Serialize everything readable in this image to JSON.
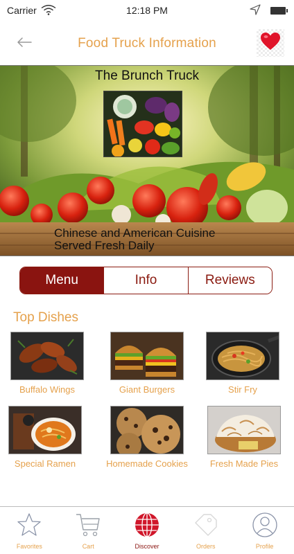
{
  "status_bar": {
    "carrier": "Carrier",
    "time": "12:18 PM"
  },
  "nav": {
    "title": "Food Truck Information",
    "back_icon": "arrow-left-icon",
    "favorite_icon": "heart-icon"
  },
  "hero": {
    "truck_name": "The Brunch Truck",
    "tagline_line1": "Chinese and American Cuisine",
    "tagline_line2": "Served Fresh Daily"
  },
  "tabs": [
    {
      "label": "Menu",
      "active": true
    },
    {
      "label": "Info",
      "active": false
    },
    {
      "label": "Reviews",
      "active": false
    }
  ],
  "top_dishes": {
    "title": "Top Dishes",
    "items": [
      {
        "label": "Buffalo Wings"
      },
      {
        "label": "Giant Burgers"
      },
      {
        "label": "Stir Fry"
      },
      {
        "label": "Special Ramen"
      },
      {
        "label": "Homemade Cookies"
      },
      {
        "label": "Fresh Made Pies"
      }
    ]
  },
  "tab_bar": [
    {
      "label": "Favorites",
      "icon": "star-icon"
    },
    {
      "label": "Cart",
      "icon": "cart-icon"
    },
    {
      "label": "Discover",
      "icon": "globe-icon",
      "active": true
    },
    {
      "label": "Orders",
      "icon": "tag-icon"
    },
    {
      "label": "Profile",
      "icon": "user-icon"
    }
  ],
  "colors": {
    "accent": "#e5a14c",
    "primary": "#8a1410",
    "heart": "#e0142a"
  }
}
